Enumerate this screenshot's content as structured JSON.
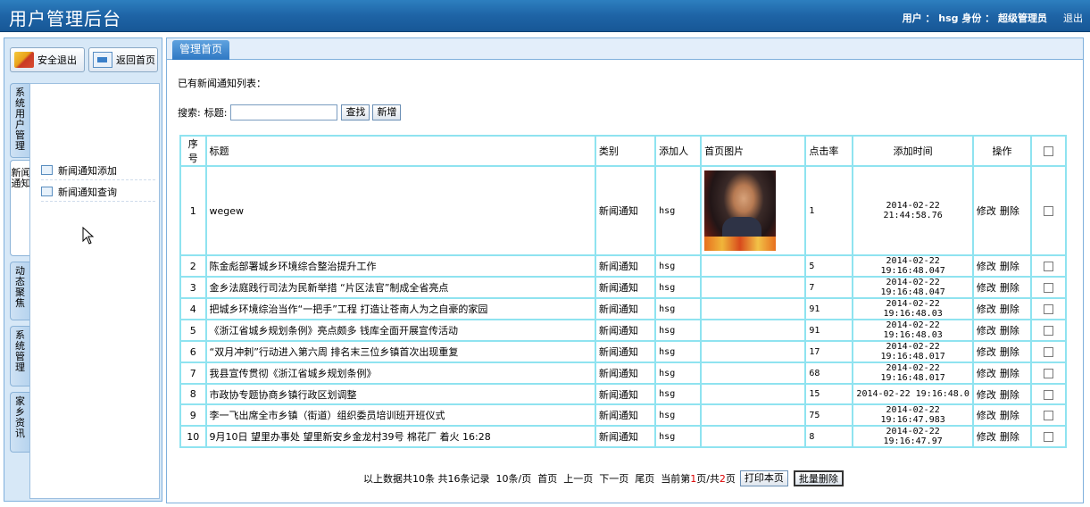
{
  "header": {
    "title": "用户管理后台",
    "user_info": "用户 ： hsg  身份 ： 超级管理员",
    "logout": "退出"
  },
  "sidebar": {
    "exit_button": "安全退出",
    "home_button": "返回首页",
    "tabs": [
      "系统用户管理",
      "新闻通知",
      "动态聚焦",
      "系统管理",
      "家乡资讯"
    ],
    "active_tab": 1,
    "menu": [
      "新闻通知添加",
      "新闻通知查询"
    ]
  },
  "main": {
    "tab": "管理首页",
    "list_title": "已有新闻通知列表：",
    "search_label": "搜索:",
    "title_label": "标题:",
    "search_value": "",
    "find_button": "查找",
    "add_button": "新增",
    "columns": [
      "序号",
      "标题",
      "类别",
      "添加人",
      "首页图片",
      "点击率",
      "添加时间",
      "操作"
    ],
    "rows": [
      {
        "no": "1",
        "title": "wegew",
        "category": "新闻通知",
        "user": "hsg",
        "has_image": true,
        "hits": "1",
        "time": "2014-02-22 21:44:58.76"
      },
      {
        "no": "2",
        "title": "陈金彪部署城乡环境综合整治提升工作",
        "category": "新闻通知",
        "user": "hsg",
        "has_image": false,
        "hits": "5",
        "time": "2014-02-22 19:16:48.047"
      },
      {
        "no": "3",
        "title": "金乡法庭践行司法为民新举措 “片区法官”制成全省亮点",
        "category": "新闻通知",
        "user": "hsg",
        "has_image": false,
        "hits": "7",
        "time": "2014-02-22 19:16:48.047"
      },
      {
        "no": "4",
        "title": "把城乡环境综治当作“一把手”工程 打造让苍南人为之自豪的家园",
        "category": "新闻通知",
        "user": "hsg",
        "has_image": false,
        "hits": "91",
        "time": "2014-02-22 19:16:48.03"
      },
      {
        "no": "5",
        "title": "《浙江省城乡规划条例》亮点颇多 钱库全面开展宣传活动",
        "category": "新闻通知",
        "user": "hsg",
        "has_image": false,
        "hits": "91",
        "time": "2014-02-22 19:16:48.03"
      },
      {
        "no": "6",
        "title": "“双月冲刺”行动进入第六周 排名末三位乡镇首次出现重复",
        "category": "新闻通知",
        "user": "hsg",
        "has_image": false,
        "hits": "17",
        "time": "2014-02-22 19:16:48.017"
      },
      {
        "no": "7",
        "title": "我县宣传贯彻《浙江省城乡规划条例》",
        "category": "新闻通知",
        "user": "hsg",
        "has_image": false,
        "hits": "68",
        "time": "2014-02-22 19:16:48.017"
      },
      {
        "no": "8",
        "title": "市政协专题协商乡镇行政区划调整",
        "category": "新闻通知",
        "user": "hsg",
        "has_image": false,
        "hits": "15",
        "time": "2014-02-22 19:16:48.0"
      },
      {
        "no": "9",
        "title": "李一飞出席全市乡镇（街道）组织委员培训班开班仪式",
        "category": "新闻通知",
        "user": "hsg",
        "has_image": false,
        "hits": "75",
        "time": "2014-02-22 19:16:47.983"
      },
      {
        "no": "10",
        "title": "9月10日 望里办事处 望里新安乡金龙村39号 棉花厂 着火 16:28",
        "category": "新闻通知",
        "user": "hsg",
        "has_image": false,
        "hits": "8",
        "time": "2014-02-22 19:16:47.97"
      }
    ],
    "edit_label": "修改",
    "delete_label": "删除"
  },
  "pager": {
    "summary": "以上数据共10条 共16条记录",
    "per_page": "10条/页",
    "first": "首页",
    "prev": "上一页",
    "next": "下一页",
    "last": "尾页",
    "current_prefix": "当前第",
    "current_page": "1",
    "current_mid": "页/共",
    "total_pages": "2",
    "current_suffix": "页",
    "print_button": "打印本页",
    "batch_delete_button": "批量删除"
  }
}
